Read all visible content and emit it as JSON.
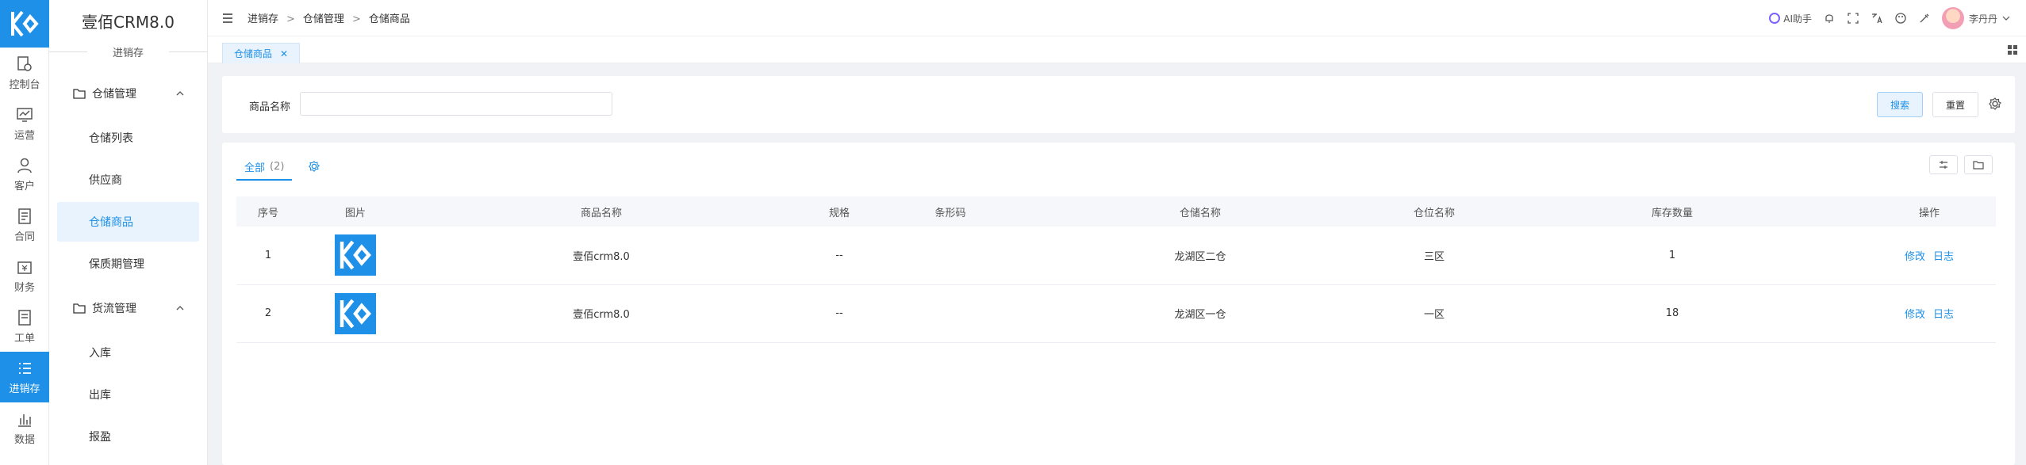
{
  "rail": {
    "items": [
      {
        "label": "控制台",
        "icon": "dashboard-icon"
      },
      {
        "label": "运营",
        "icon": "chart-icon"
      },
      {
        "label": "客户",
        "icon": "user-icon"
      },
      {
        "label": "合同",
        "icon": "contract-icon"
      },
      {
        "label": "财务",
        "icon": "wallet-icon"
      },
      {
        "label": "工单",
        "icon": "ticket-icon"
      },
      {
        "label": "进销存",
        "icon": "list-icon"
      },
      {
        "label": "数据",
        "icon": "bar-chart-icon"
      }
    ]
  },
  "menu": {
    "title": "壹佰CRM8.0",
    "subtitle": "进销存",
    "group1": {
      "label": "仓储管理"
    },
    "group1_items": [
      {
        "label": "仓储列表"
      },
      {
        "label": "供应商"
      },
      {
        "label": "仓储商品"
      },
      {
        "label": "保质期管理"
      }
    ],
    "group2": {
      "label": "货流管理"
    },
    "group2_items": [
      {
        "label": "入库"
      },
      {
        "label": "出库"
      },
      {
        "label": "报盈"
      }
    ]
  },
  "topbar": {
    "crumbs": [
      "进销存",
      "仓储管理",
      "仓储商品"
    ],
    "ai_label": "AI助手",
    "user_name": "李丹丹"
  },
  "tabs": {
    "active": "仓储商品"
  },
  "search": {
    "label": "商品名称",
    "value": "",
    "placeholder": "",
    "search_btn": "搜索",
    "reset_btn": "重置"
  },
  "list": {
    "tab_label": "全部",
    "tab_count": "(2)",
    "columns": [
      "序号",
      "图片",
      "商品名称",
      "规格",
      "条形码",
      "仓储名称",
      "仓位名称",
      "库存数量",
      "操作"
    ],
    "rows": [
      {
        "idx": "1",
        "name": "壹佰crm8.0",
        "spec": "--",
        "barcode": "",
        "warehouse": "龙湖区二仓",
        "slot": "三区",
        "qty": "1",
        "edit": "修改",
        "log": "日志"
      },
      {
        "idx": "2",
        "name": "壹佰crm8.0",
        "spec": "--",
        "barcode": "",
        "warehouse": "龙湖区一仓",
        "slot": "一区",
        "qty": "18",
        "edit": "修改",
        "log": "日志"
      }
    ]
  },
  "colors": {
    "accent": "#1e90e8"
  }
}
